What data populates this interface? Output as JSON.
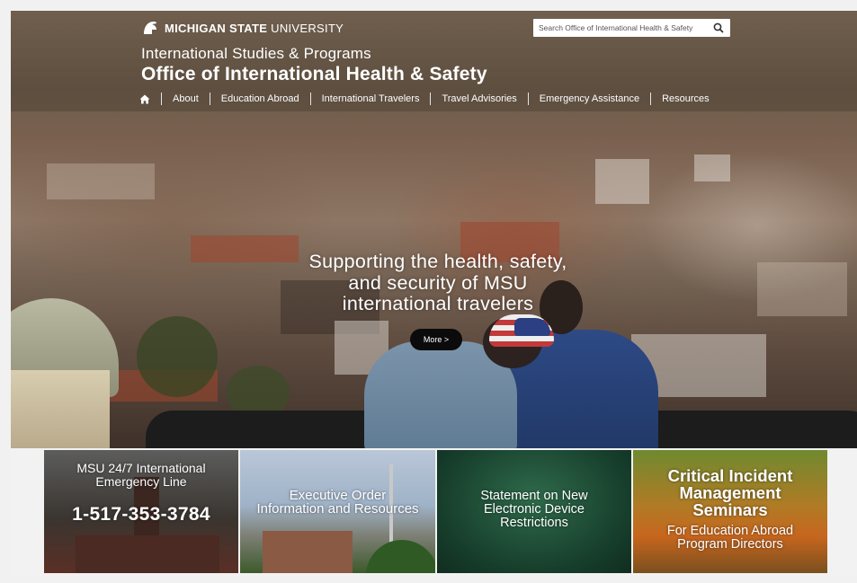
{
  "header": {
    "university_name_bold": "MICHIGAN STATE",
    "university_name_rest": "UNIVERSITY",
    "unit_title": "International Studies & Programs",
    "site_title": "Office of International Health & Safety",
    "search_placeholder": "Search Office of International Health & Safety"
  },
  "nav": {
    "items": [
      {
        "label": "About"
      },
      {
        "label": "Education Abroad"
      },
      {
        "label": "International Travelers"
      },
      {
        "label": "Travel Advisories"
      },
      {
        "label": "Emergency Assistance"
      },
      {
        "label": "Resources"
      }
    ],
    "home_icon": "home-icon"
  },
  "hero": {
    "tagline_line1": "Supporting the health, safety,",
    "tagline_line2": "and security of MSU",
    "tagline_line3": "international travelers",
    "more_label": "More >"
  },
  "tiles": {
    "emergency": {
      "title_line1": "MSU 24/7 International",
      "title_line2": "Emergency Line",
      "phone": "1-517-353-3784"
    },
    "executive": {
      "title_line1": "Executive Order",
      "title_line2": "Information and Resources"
    },
    "statement": {
      "title_line1": "Statement on New",
      "title_line2": "Electronic Device",
      "title_line3": "Restrictions"
    },
    "seminars": {
      "title_line1": "Critical Incident",
      "title_line2": "Management",
      "title_line3": "Seminars",
      "sub_line1": "For Education Abroad",
      "sub_line2": "Program Directors"
    }
  },
  "colors": {
    "header_text": "#ffffff",
    "more_button_bg": "#0b0b0b",
    "page_bg": "#f2f2f2"
  }
}
